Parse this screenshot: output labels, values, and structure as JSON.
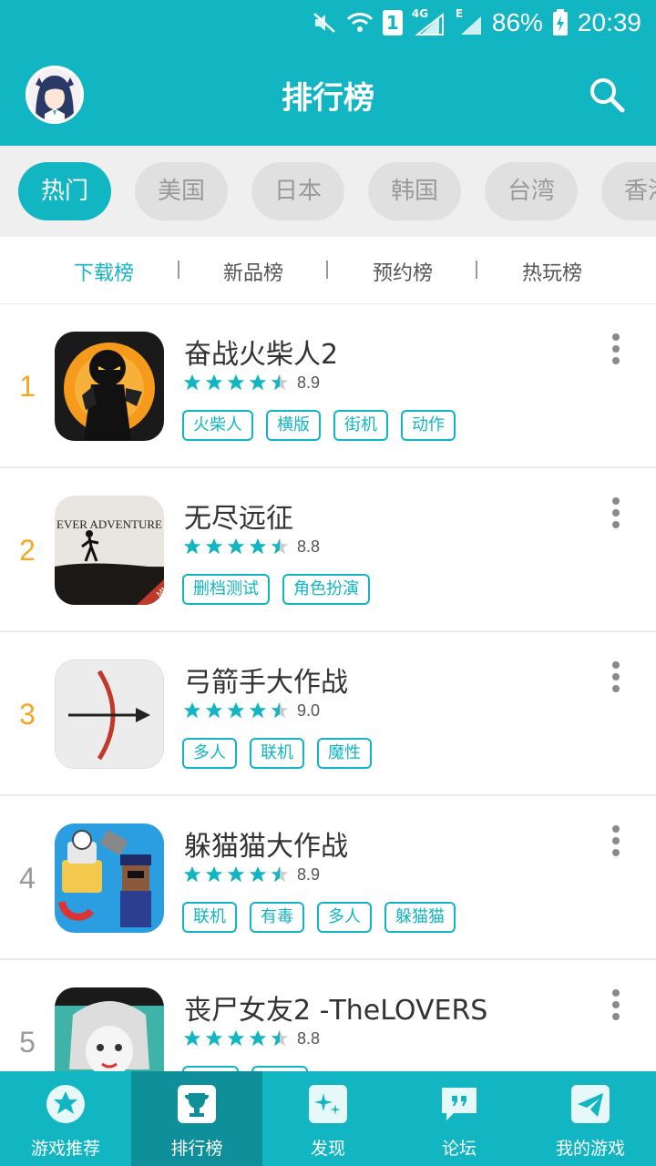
{
  "status_bar": {
    "network": "4G",
    "signal_e": "E",
    "sim": "1",
    "battery": "86%",
    "time": "20:39"
  },
  "header": {
    "title": "排行榜",
    "avatar": "user-avatar",
    "search_icon": "search-icon"
  },
  "regions": [
    "热门",
    "美国",
    "日本",
    "韩国",
    "台湾",
    "香港"
  ],
  "active_region": "热门",
  "subtabs": [
    "下载榜",
    "新品榜",
    "预约榜",
    "热玩榜"
  ],
  "active_subtab": "下载榜",
  "games": [
    {
      "rank": "1",
      "name": "奋战火柴人2",
      "rating": 4.5,
      "score": "8.9",
      "tags": [
        "火柴人",
        "横版",
        "街机",
        "动作"
      ]
    },
    {
      "rank": "2",
      "name": "无尽远征",
      "rating": 4.5,
      "score": "8.8",
      "tags": [
        "删档测试",
        "角色扮演"
      ],
      "icon_text": "EVER ADVENTURE",
      "icon_badge": "MMO"
    },
    {
      "rank": "3",
      "name": "弓箭手大作战",
      "rating": 4.5,
      "score": "9.0",
      "tags": [
        "多人",
        "联机",
        "魔性"
      ]
    },
    {
      "rank": "4",
      "name": "躲猫猫大作战",
      "rating": 4.5,
      "score": "8.9",
      "tags": [
        "联机",
        "有毒",
        "多人",
        "躲猫猫"
      ]
    },
    {
      "rank": "5",
      "name": "丧尸女友2 -TheLOVERS",
      "rating": 4.5,
      "score": "8.8",
      "tags": [
        "",
        ""
      ]
    }
  ],
  "bottom_nav": [
    {
      "label": "游戏推荐",
      "icon": "star-icon"
    },
    {
      "label": "排行榜",
      "icon": "trophy-icon"
    },
    {
      "label": "发现",
      "icon": "sparkle-icon"
    },
    {
      "label": "论坛",
      "icon": "chat-quote-icon"
    },
    {
      "label": "我的游戏",
      "icon": "paper-plane-icon"
    }
  ],
  "colors": {
    "primary": "#12b5c2",
    "rank_top": "#f5a623",
    "rank_normal": "#999999",
    "active_nav": "#0e8f99"
  }
}
